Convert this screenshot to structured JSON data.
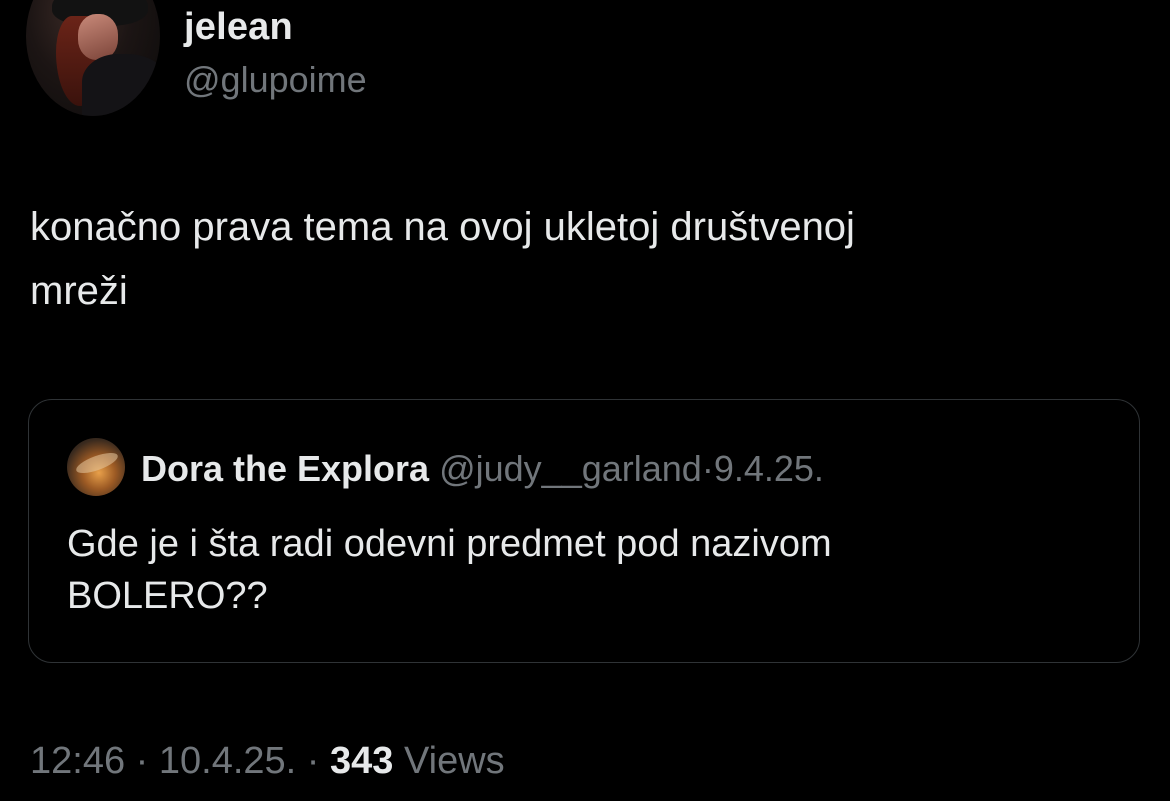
{
  "tweet": {
    "author": {
      "display_name": "jelean",
      "handle": "@glupoime"
    },
    "text_line1": "konačno prava tema na ovoj ukletoj društvenoj",
    "text_line2": "mreži",
    "quoted_tweet": {
      "author_name": "Dora the Explora",
      "author_handle": "@judy__garland",
      "separator": "·",
      "date": "9.4.25.",
      "text_line1": "Gde je i šta radi odevni predmet pod nazivom",
      "text_line2": "BOLERO??"
    },
    "meta": {
      "time": "12:46",
      "separator": "·",
      "date": "10.4.25.",
      "views_count": "343",
      "views_label": "Views"
    }
  },
  "colors": {
    "background": "#000000",
    "primary_text": "#e7e9ea",
    "secondary_text": "#71767b",
    "border": "#2f3336"
  }
}
